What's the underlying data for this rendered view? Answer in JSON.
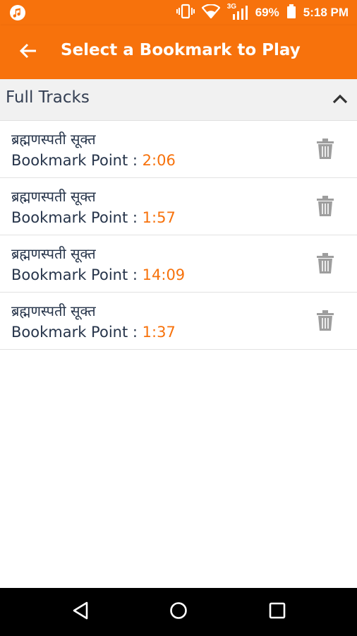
{
  "status_bar": {
    "battery_percent": "69%",
    "time": "5:18 PM",
    "network_type": "3G",
    "icons": [
      "app-music-icon",
      "vibrate-icon",
      "wifi-icon",
      "signal-icon",
      "battery-icon"
    ]
  },
  "app_bar": {
    "title": "Select a Bookmark to Play",
    "back_icon": "arrow-left-icon",
    "background_color": "#f7720c"
  },
  "section": {
    "title": "Full Tracks",
    "toggle_icon": "chevron-up-icon",
    "expanded": true
  },
  "bookmark_label": "Bookmark Point : ",
  "bookmarks": [
    {
      "title": "ब्रह्मणस्पती सूक्त",
      "time": "2:06"
    },
    {
      "title": "ब्रह्मणस्पती सूक्त",
      "time": "1:57"
    },
    {
      "title": "ब्रह्मणस्पती सूक्त",
      "time": "14:09"
    },
    {
      "title": "ब्रह्मणस्पती सूक्त",
      "time": "1:37"
    }
  ],
  "colors": {
    "accent": "#f7720c",
    "text_primary": "#26344a",
    "icon_gray": "#9e9e9e"
  },
  "nav_bar": {
    "icons": [
      "back-triangle-icon",
      "home-circle-icon",
      "recents-square-icon"
    ]
  }
}
